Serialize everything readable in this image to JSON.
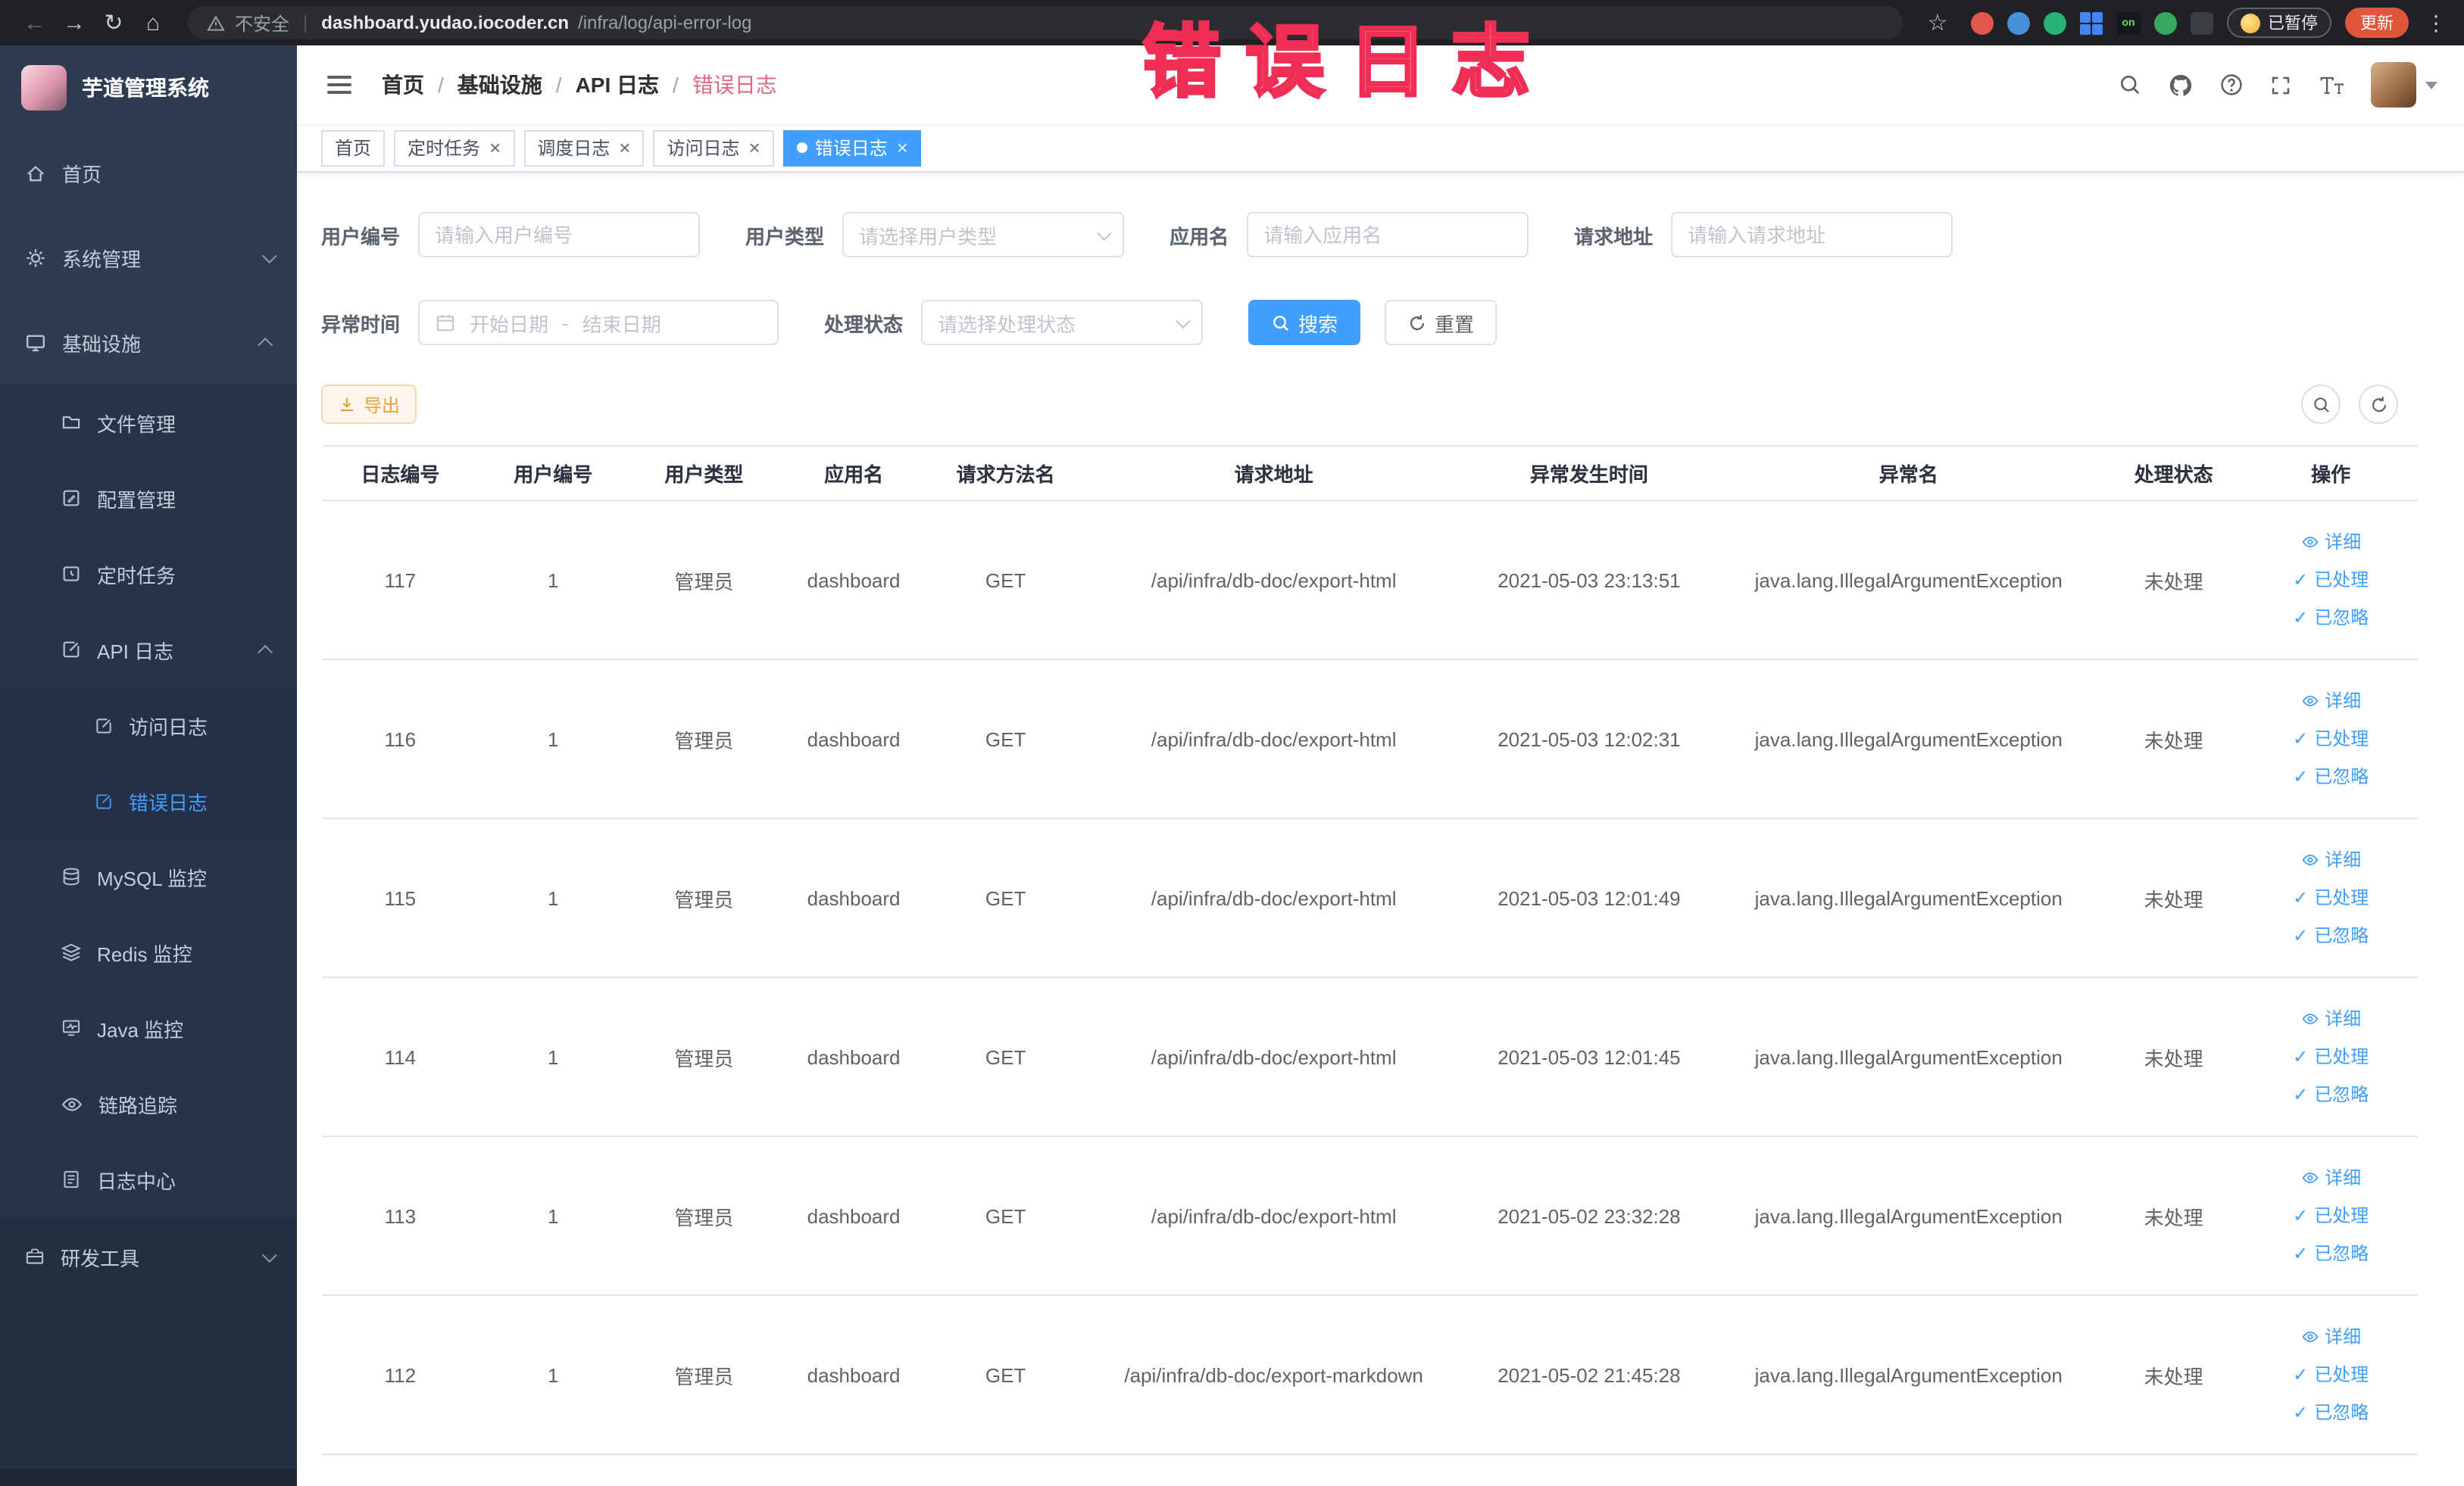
{
  "browser": {
    "security_label": "不安全",
    "url_host": "dashboard.yudao.iocoder.cn",
    "url_path": "/infra/log/api-error-log",
    "on_badge": "on",
    "paused_badge": "已暂停",
    "update_label": "更新",
    "extensions": [
      {
        "name": "extension-orange-circle",
        "color": "#e2574c"
      },
      {
        "name": "extension-blue-drop",
        "color": "#4a90d9"
      },
      {
        "name": "extension-green-circle",
        "color": "#27b376"
      },
      {
        "name": "extension-blue-grid",
        "color": "#4285f4"
      },
      {
        "name": "extension-on-badge",
        "color": "#6ddb4f"
      },
      {
        "name": "extension-green-leaf",
        "color": "#35a85b"
      },
      {
        "name": "extension-dark-paw",
        "color": "#3a3d41"
      }
    ]
  },
  "annotation": {
    "text": "错误日志"
  },
  "sidebar": {
    "logo_title": "芋道管理系统",
    "items": [
      {
        "label": "首页",
        "icon": "home-icon"
      },
      {
        "label": "系统管理",
        "icon": "gear-icon"
      },
      {
        "label": "基础设施",
        "icon": "monitor-icon"
      },
      {
        "label": "文件管理",
        "icon": "folder-icon"
      },
      {
        "label": "配置管理",
        "icon": "edit-icon"
      },
      {
        "label": "定时任务",
        "icon": "schedule-icon"
      },
      {
        "label": "API 日志",
        "icon": "log-icon"
      },
      {
        "label": "访问日志",
        "icon": "doc-icon"
      },
      {
        "label": "错误日志",
        "icon": "doc-icon",
        "active": true
      },
      {
        "label": "MySQL 监控",
        "icon": "database-icon"
      },
      {
        "label": "Redis 监控",
        "icon": "layers-icon"
      },
      {
        "label": "Java 监控",
        "icon": "java-icon"
      },
      {
        "label": "链路追踪",
        "icon": "eye-icon"
      },
      {
        "label": "日志中心",
        "icon": "doc-lines-icon"
      },
      {
        "label": "研发工具",
        "icon": "toolbox-icon"
      }
    ]
  },
  "header": {
    "breadcrumb": [
      "首页",
      "基础设施",
      "API 日志",
      "错误日志"
    ],
    "breadcrumb_separator": "/"
  },
  "tabs": [
    {
      "label": "首页",
      "closable": false,
      "active": false
    },
    {
      "label": "定时任务",
      "closable": true,
      "active": false
    },
    {
      "label": "调度日志",
      "closable": true,
      "active": false
    },
    {
      "label": "访问日志",
      "closable": true,
      "active": false
    },
    {
      "label": "错误日志",
      "closable": true,
      "active": true
    }
  ],
  "filters": {
    "user_no": {
      "label": "用户编号",
      "placeholder": "请输入用户编号"
    },
    "user_type": {
      "label": "用户类型",
      "placeholder": "请选择用户类型"
    },
    "app_name": {
      "label": "应用名",
      "placeholder": "请输入应用名"
    },
    "req_url": {
      "label": "请求地址",
      "placeholder": "请输入请求地址"
    },
    "exc_time": {
      "label": "异常时间",
      "start_placeholder": "开始日期",
      "separator": "-",
      "end_placeholder": "结束日期"
    },
    "status": {
      "label": "处理状态",
      "placeholder": "请选择处理状态"
    },
    "search_label": "搜索",
    "reset_label": "重置"
  },
  "toolbar": {
    "export_label": "导出"
  },
  "table": {
    "columns": [
      "日志编号",
      "用户编号",
      "用户类型",
      "应用名",
      "请求方法名",
      "请求地址",
      "异常发生时间",
      "异常名",
      "处理状态",
      "操作"
    ],
    "actions": {
      "detail": "详细",
      "processed": "已处理",
      "ignored": "已忽略"
    },
    "rows": [
      {
        "id": "117",
        "user_id": "1",
        "user_type": "管理员",
        "app": "dashboard",
        "method": "GET",
        "url": "/api/infra/db-doc/export-html",
        "time": "2021-05-03 23:13:51",
        "exception": "java.lang.IllegalArgumentException",
        "status": "未处理"
      },
      {
        "id": "116",
        "user_id": "1",
        "user_type": "管理员",
        "app": "dashboard",
        "method": "GET",
        "url": "/api/infra/db-doc/export-html",
        "time": "2021-05-03 12:02:31",
        "exception": "java.lang.IllegalArgumentException",
        "status": "未处理"
      },
      {
        "id": "115",
        "user_id": "1",
        "user_type": "管理员",
        "app": "dashboard",
        "method": "GET",
        "url": "/api/infra/db-doc/export-html",
        "time": "2021-05-03 12:01:49",
        "exception": "java.lang.IllegalArgumentException",
        "status": "未处理"
      },
      {
        "id": "114",
        "user_id": "1",
        "user_type": "管理员",
        "app": "dashboard",
        "method": "GET",
        "url": "/api/infra/db-doc/export-html",
        "time": "2021-05-03 12:01:45",
        "exception": "java.lang.IllegalArgumentException",
        "status": "未处理"
      },
      {
        "id": "113",
        "user_id": "1",
        "user_type": "管理员",
        "app": "dashboard",
        "method": "GET",
        "url": "/api/infra/db-doc/export-html",
        "time": "2021-05-02 23:32:28",
        "exception": "java.lang.IllegalArgumentException",
        "status": "未处理"
      },
      {
        "id": "112",
        "user_id": "1",
        "user_type": "管理员",
        "app": "dashboard",
        "method": "GET",
        "url": "/api/infra/db-doc/export-markdown",
        "time": "2021-05-02 21:45:28",
        "exception": "java.lang.IllegalArgumentException",
        "status": "未处理"
      }
    ]
  },
  "colors": {
    "primary": "#409eff",
    "warning": "#e6a23c",
    "sidebar_bg": "#2e3b50",
    "annotation": "#ef2d55"
  }
}
